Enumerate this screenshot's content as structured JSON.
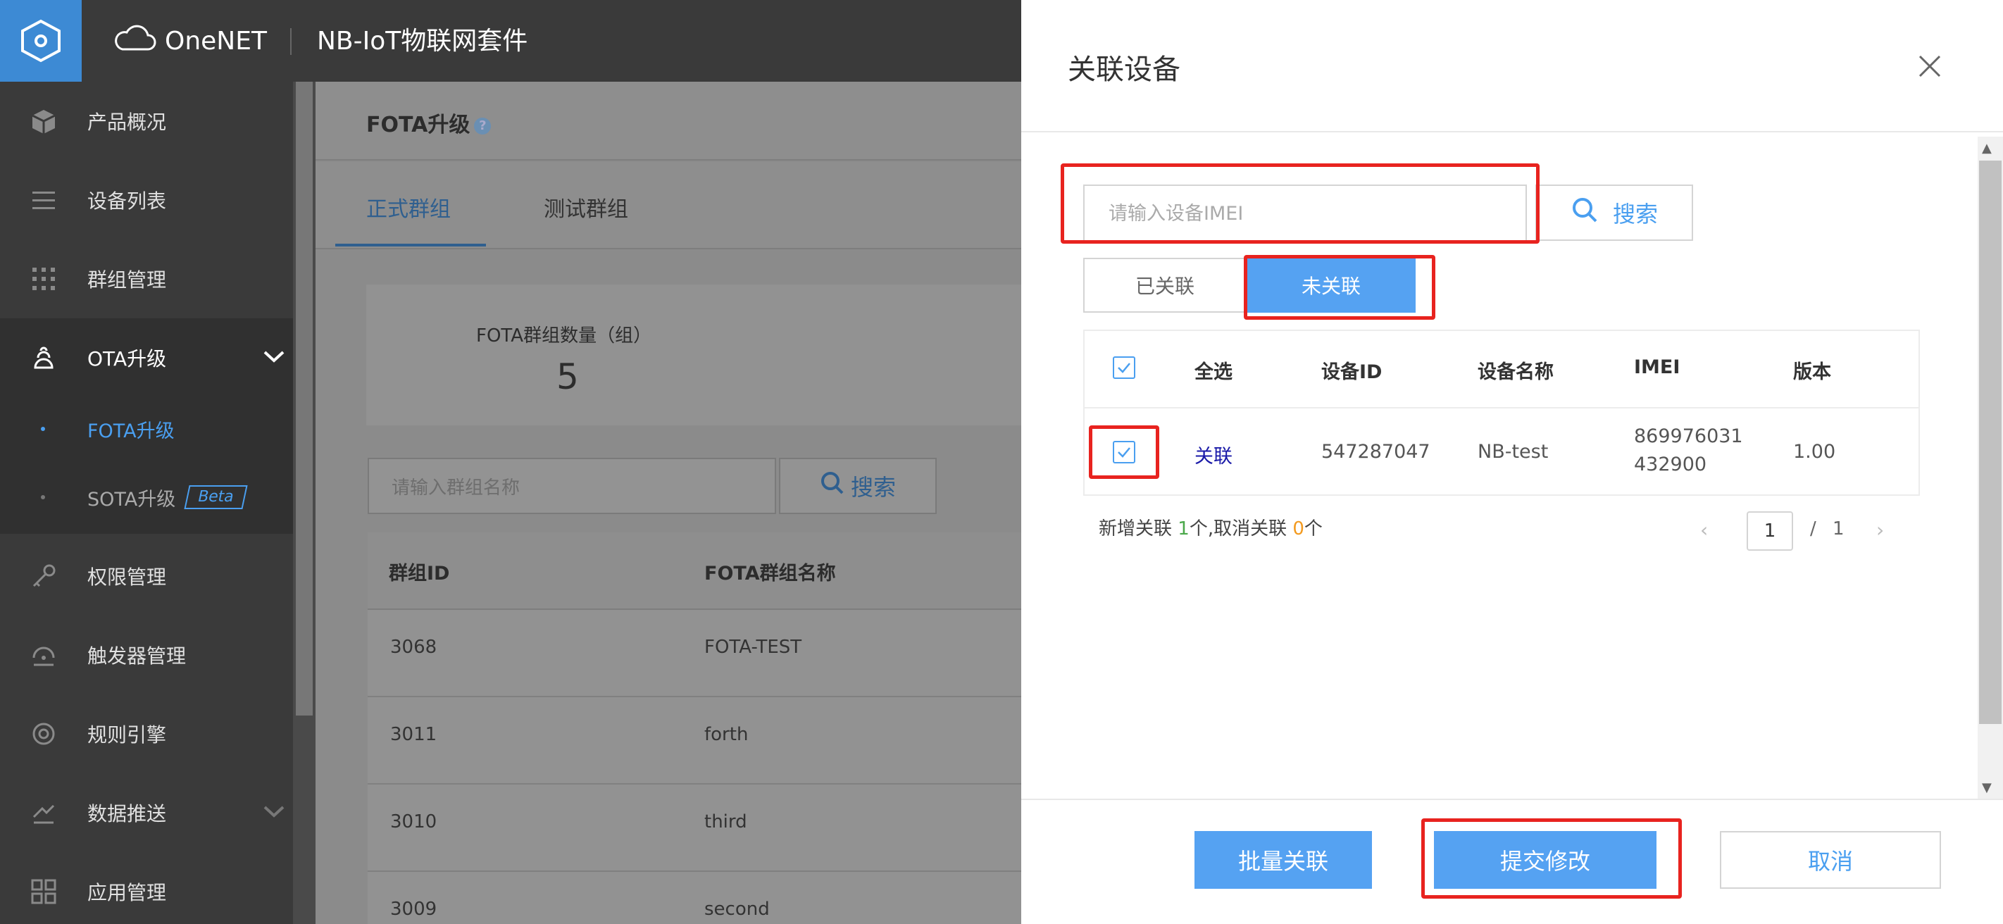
{
  "header": {
    "brand": "OneNET",
    "product": "NB-IoT物联网套件"
  },
  "sidebar": {
    "items": [
      {
        "label": "产品概况",
        "icon": "cube-icon"
      },
      {
        "label": "设备列表",
        "icon": "list-icon"
      },
      {
        "label": "群组管理",
        "icon": "grid-dots-icon"
      },
      {
        "label": "OTA升级",
        "icon": "ota-icon"
      },
      {
        "label": "权限管理",
        "icon": "key-icon"
      },
      {
        "label": "触发器管理",
        "icon": "trigger-icon"
      },
      {
        "label": "规则引擎",
        "icon": "rule-icon"
      },
      {
        "label": "数据推送",
        "icon": "push-icon"
      },
      {
        "label": "应用管理",
        "icon": "apps-icon"
      }
    ],
    "ota_sub": [
      {
        "label": "FOTA升级"
      },
      {
        "label": "SOTA升级",
        "badge": "Beta"
      }
    ]
  },
  "main": {
    "title": "FOTA升级",
    "help": "?",
    "tabs": [
      "正式群组",
      "测试群组"
    ],
    "stat_label": "FOTA群组数量（组）",
    "stat_value": "5",
    "search_placeholder": "请输入群组名称",
    "search_label": "搜索",
    "table": {
      "headers": [
        "群组ID",
        "FOTA群组名称"
      ],
      "rows": [
        [
          "3068",
          "FOTA-TEST"
        ],
        [
          "3011",
          "forth"
        ],
        [
          "3010",
          "third"
        ],
        [
          "3009",
          "second"
        ]
      ]
    }
  },
  "modal": {
    "title": "关联设备",
    "imei_placeholder": "请输入设备IMEI",
    "search_label": "搜索",
    "segments": [
      "已关联",
      "未关联"
    ],
    "table": {
      "headers": [
        "全选",
        "设备ID",
        "设备名称",
        "IMEI",
        "版本"
      ],
      "row": {
        "action": "关联",
        "device_id": "547287047",
        "device_name": "NB-test",
        "imei_line1": "869976031",
        "imei_line2": "432900",
        "version": "1.00"
      }
    },
    "summary": {
      "prefix": "新增关联 ",
      "added": "1",
      "middle": "个,取消关联 ",
      "removed": "0",
      "suffix": "个"
    },
    "pager": {
      "current": "1",
      "slash": "/",
      "total": "1"
    },
    "buttons": {
      "batch": "批量关联",
      "submit": "提交修改",
      "cancel": "取消"
    }
  },
  "colors": {
    "accent": "#55a2f2",
    "highlight": "#e8231f",
    "sidebar": "#3a3a3a"
  }
}
